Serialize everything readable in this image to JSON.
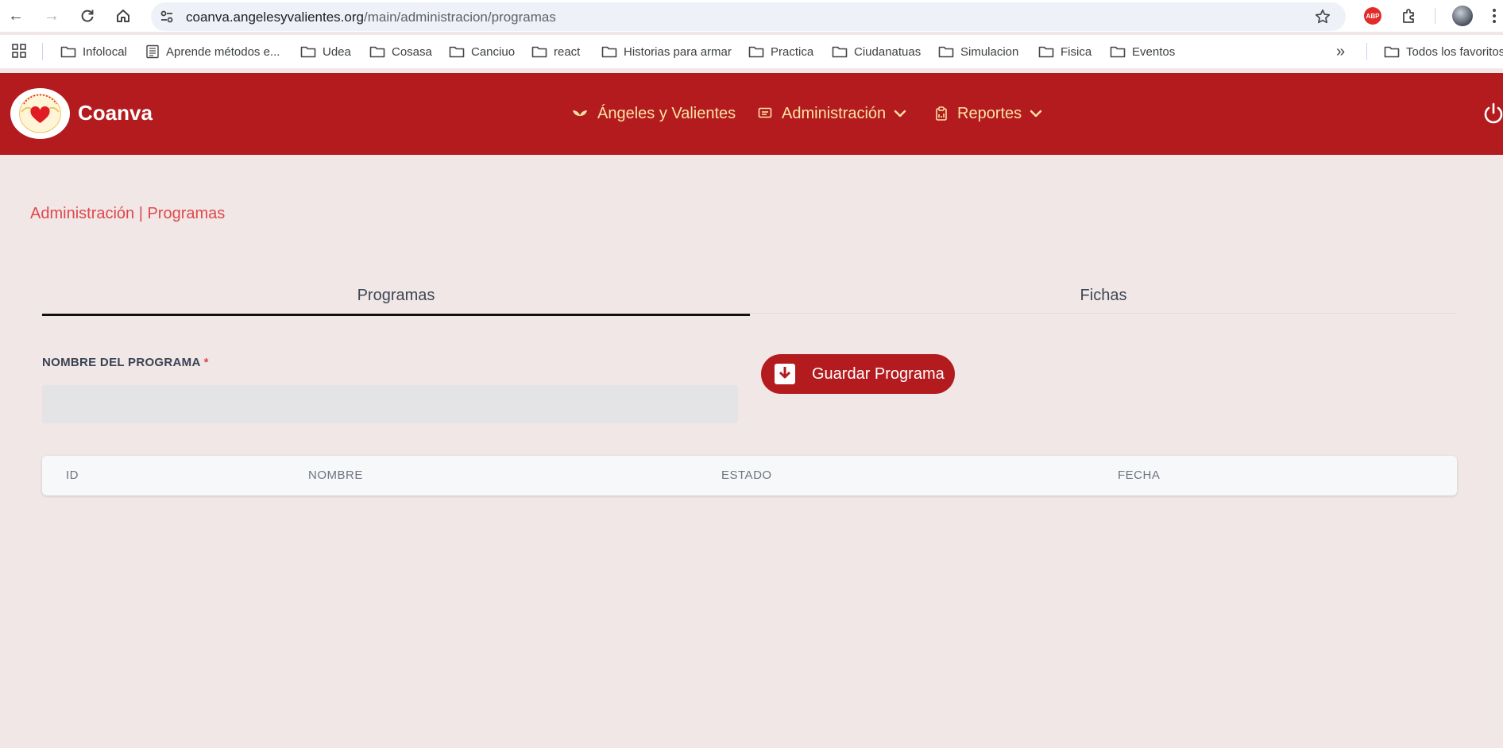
{
  "browser": {
    "url_host": "coanva.angelesyvalientes.org",
    "url_path": "/main/administracion/programas",
    "extension_badge": "ABP"
  },
  "bookmarks": [
    {
      "label": "Infolocal",
      "icon": "folder-icon"
    },
    {
      "label": "Aprende métodos e...",
      "icon": "page-icon"
    },
    {
      "label": "Udea",
      "icon": "folder-icon"
    },
    {
      "label": "Cosasa",
      "icon": "folder-icon"
    },
    {
      "label": "Canciuo",
      "icon": "folder-icon"
    },
    {
      "label": "react",
      "icon": "folder-icon"
    },
    {
      "label": "Historias para armar",
      "icon": "folder-icon"
    },
    {
      "label": "Practica",
      "icon": "folder-icon"
    },
    {
      "label": "Ciudanatuas",
      "icon": "folder-icon"
    },
    {
      "label": "Simulacion",
      "icon": "folder-icon"
    },
    {
      "label": "Fisica",
      "icon": "folder-icon"
    },
    {
      "label": "Eventos",
      "icon": "folder-icon"
    }
  ],
  "bookmarks_all": "Todos los favoritos",
  "header": {
    "brand": "Coanva",
    "nav": [
      {
        "label": "Ángeles y Valientes",
        "icon": "wings-icon"
      },
      {
        "label": "Administración",
        "icon": "list-icon"
      },
      {
        "label": "Reportes",
        "icon": "clipboard-icon"
      }
    ]
  },
  "breadcrumb": "Administración | Programas",
  "tabs": [
    {
      "label": "Programas",
      "active": true
    },
    {
      "label": "Fichas",
      "active": false
    }
  ],
  "form": {
    "name_label": "NOMBRE DEL PROGRAMA",
    "required_mark": "*",
    "name_value": "",
    "save_label": "Guardar Programa"
  },
  "table": {
    "columns": [
      "ID",
      "NOMBRE",
      "ESTADO",
      "FECHA"
    ],
    "rows": []
  },
  "colors": {
    "brand_red": "#b41b1e",
    "nav_text": "#fbe3a6",
    "accent_text": "#e0474c",
    "page_bg": "#f0e7e6"
  }
}
